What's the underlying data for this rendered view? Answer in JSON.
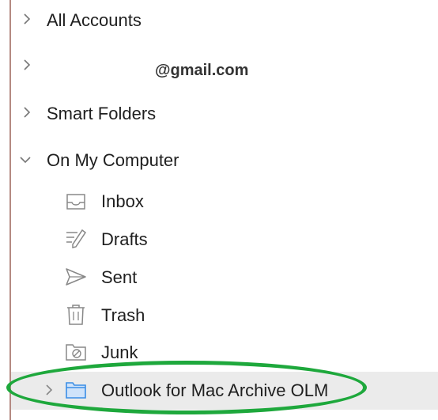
{
  "sidebar": {
    "accounts": [
      {
        "label": "All Accounts",
        "expanded": false
      },
      {
        "label": "@gmail.com",
        "expanded": false
      },
      {
        "label": "Smart Folders",
        "expanded": false
      },
      {
        "label": "On My Computer",
        "expanded": true
      }
    ],
    "folders": [
      {
        "label": "Inbox",
        "icon": "inbox-icon"
      },
      {
        "label": "Drafts",
        "icon": "drafts-icon"
      },
      {
        "label": "Sent",
        "icon": "sent-icon"
      },
      {
        "label": "Trash",
        "icon": "trash-icon"
      },
      {
        "label": "Junk",
        "icon": "junk-icon"
      }
    ],
    "selected_folder": {
      "label": "Outlook for Mac Archive OLM",
      "icon": "folder-icon",
      "expanded": false
    }
  },
  "colors": {
    "highlight_oval": "#1ea83c",
    "selection_bg": "#ebebeb",
    "folder_icon": "#3a8ee6"
  }
}
